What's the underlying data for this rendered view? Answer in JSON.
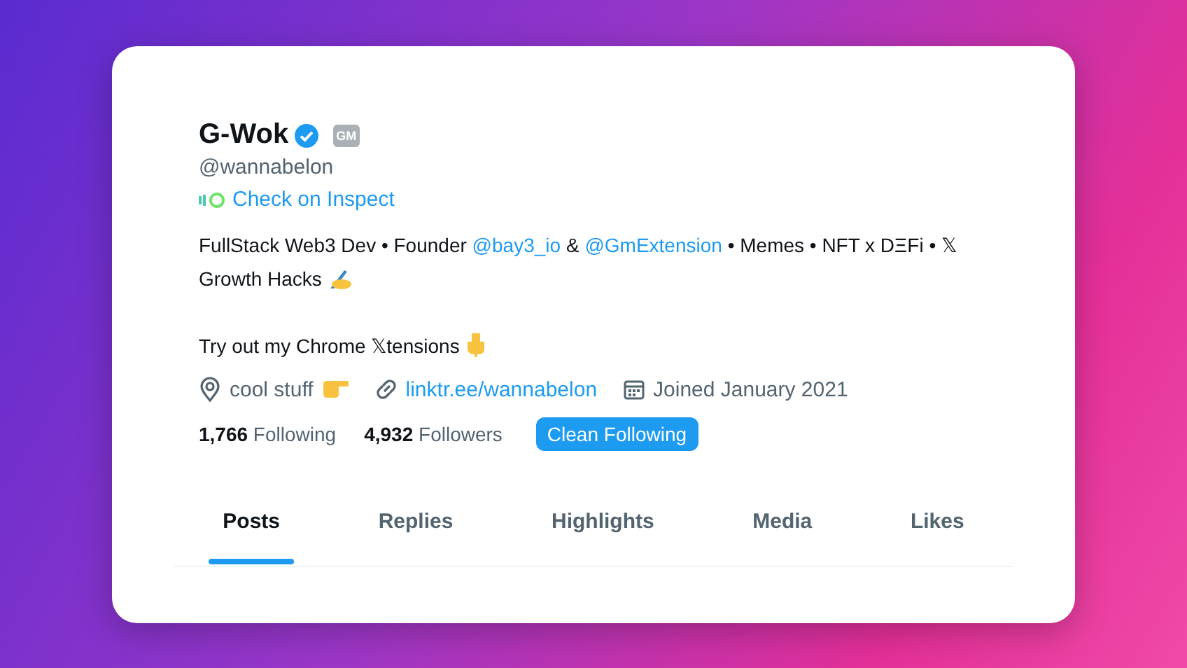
{
  "profile": {
    "name": "G-Wok",
    "verified": true,
    "badge": "GM",
    "handle": "@wannabelon",
    "inspect_link": "Check on Inspect"
  },
  "bio": [
    {
      "kind": "text",
      "text": "FullStack Web3 Dev • Founder "
    },
    {
      "kind": "mention",
      "text": "@bay3_io"
    },
    {
      "kind": "text",
      "text": " & "
    },
    {
      "kind": "mention",
      "text": "@GmExtension"
    },
    {
      "kind": "text",
      "text": " • Memes • NFT x DΞFi • 𝕏 Growth Hacks "
    },
    {
      "kind": "writing-hand"
    },
    {
      "kind": "break"
    },
    {
      "kind": "text",
      "text": "Try out my Chrome 𝕏tensions "
    },
    {
      "kind": "hand-down"
    }
  ],
  "meta": [
    {
      "kind": "location",
      "text": "cool stuff",
      "pointing_hand": true
    },
    {
      "kind": "link",
      "text": "linktr.ee/wannabelon"
    },
    {
      "kind": "joined",
      "text": "Joined January 2021"
    }
  ],
  "stats": [
    {
      "count": "1,766",
      "label": "Following"
    },
    {
      "count": "4,932",
      "label": "Followers"
    }
  ],
  "action_button": "Clean Following",
  "tabs": [
    {
      "label": "Posts",
      "selected": true
    },
    {
      "label": "Replies",
      "selected": false
    },
    {
      "label": "Highlights",
      "selected": false
    },
    {
      "label": "Media",
      "selected": false
    },
    {
      "label": "Likes",
      "selected": false
    }
  ]
}
